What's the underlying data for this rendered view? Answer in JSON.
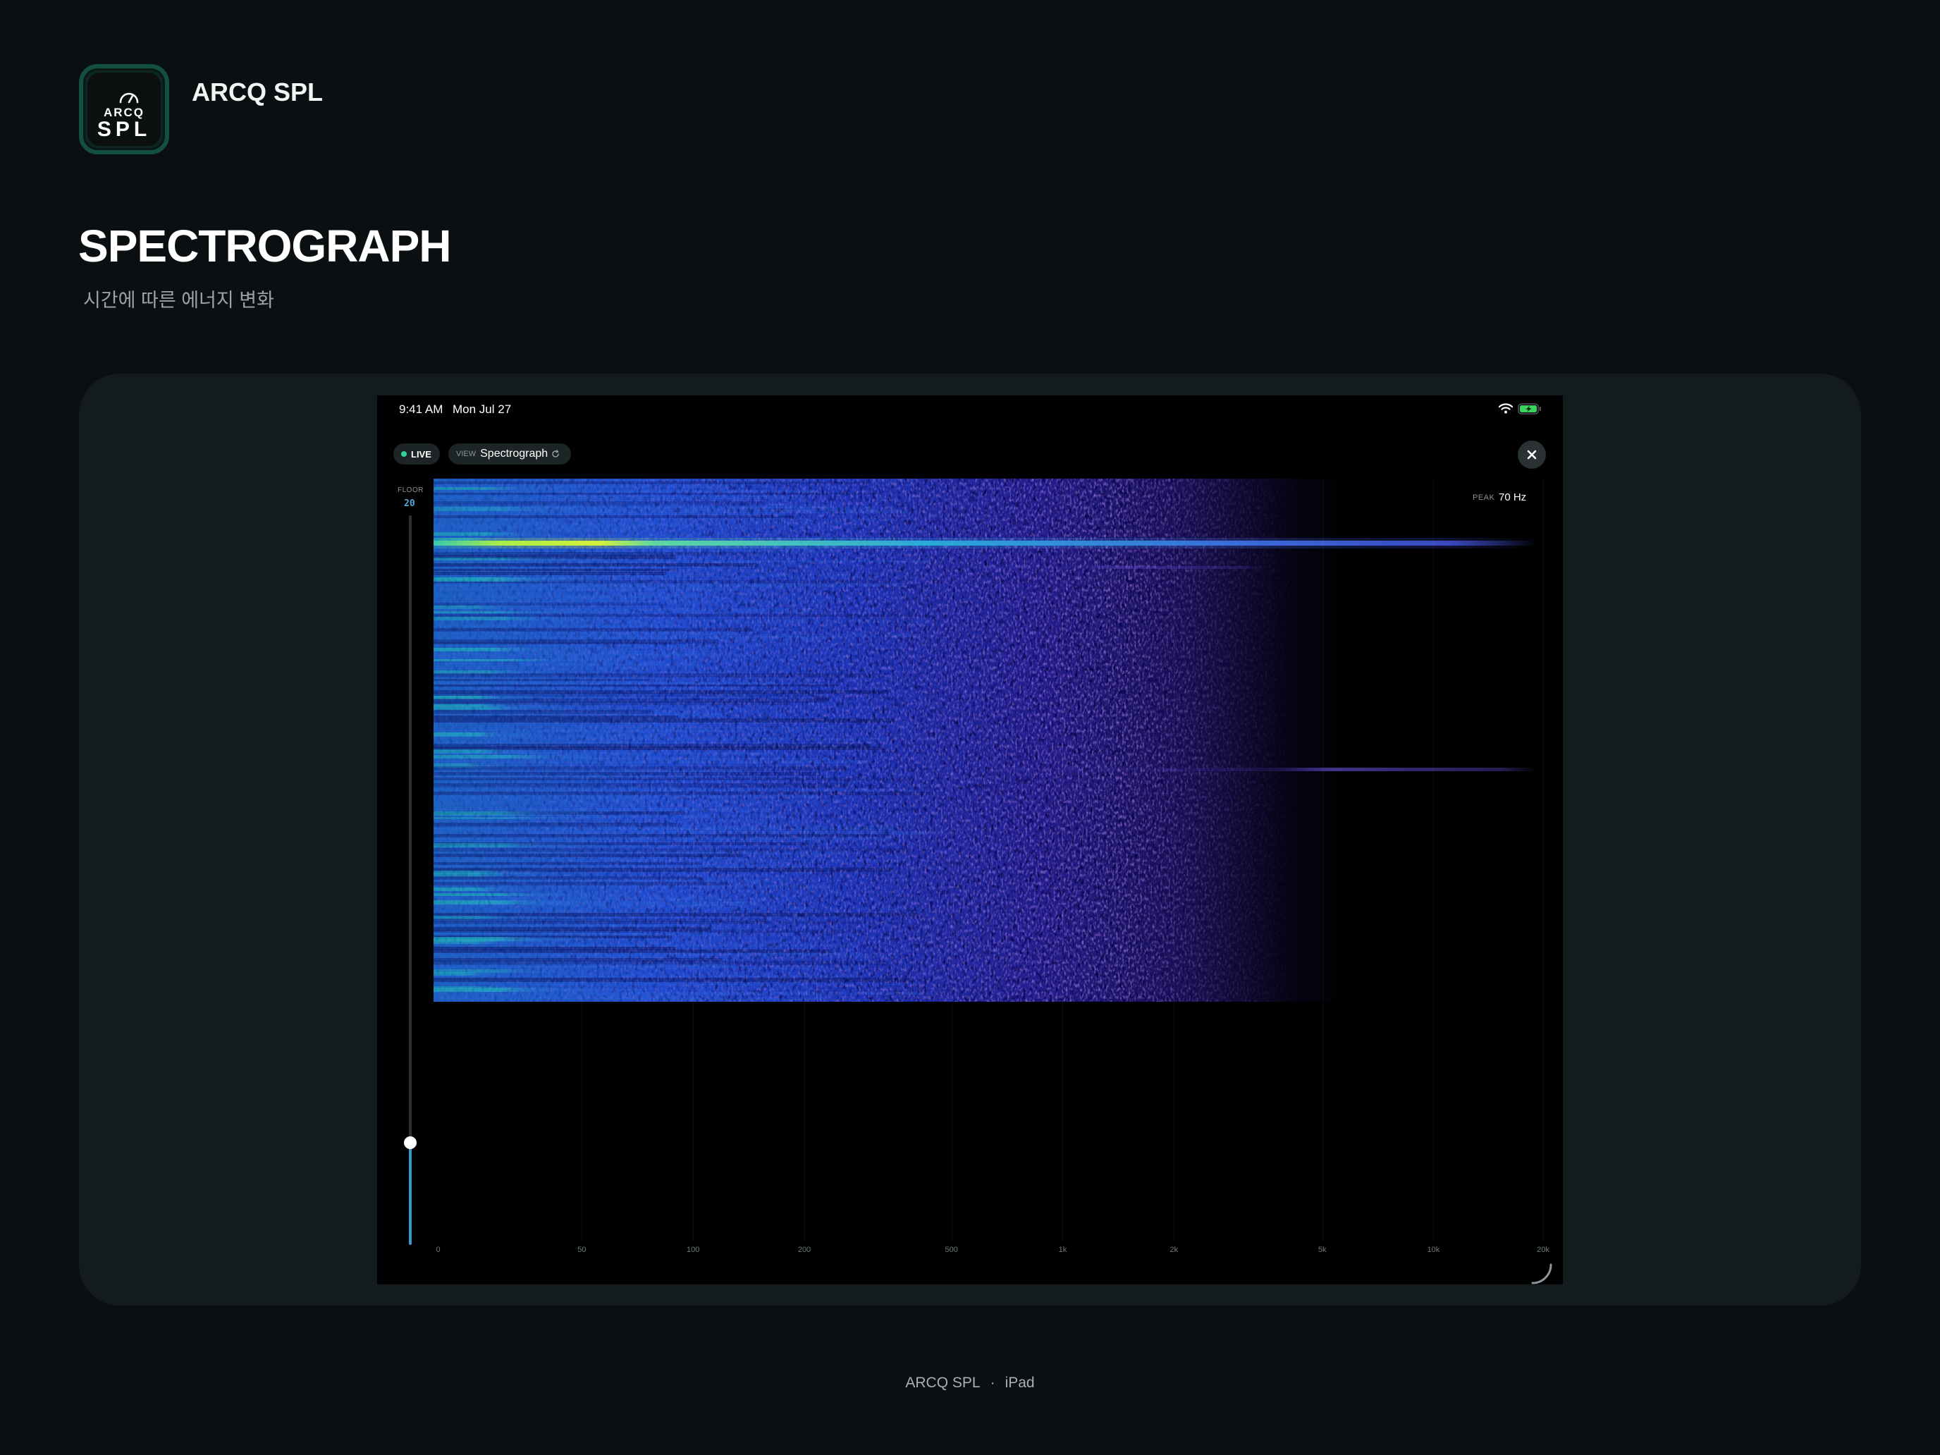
{
  "brand": {
    "icon_text_top": "ARCQ",
    "icon_text_bottom": "SPL",
    "app_name": "ARCQ SPL"
  },
  "page": {
    "title": "SPECTROGRAPH",
    "subtitle": "시간에 따른 에너지 변화"
  },
  "device": {
    "status_bar": {
      "time": "9:41 AM",
      "date": "Mon Jul 27",
      "wifi_icon": "wifi-icon",
      "battery_icon": "battery-charging-icon"
    },
    "toolbar": {
      "live_label": "LIVE",
      "live_color": "#2fd39a",
      "view_prefix": "VIEW",
      "view_value": "Spectrograph",
      "close_icon": "close-icon"
    },
    "floor": {
      "label": "FLOOR",
      "value": "20",
      "level_fraction": 0.14
    },
    "peak": {
      "label": "PEAK",
      "value": "70 Hz"
    },
    "x_ticks": [
      "0",
      "50",
      "100",
      "200",
      "500",
      "1k",
      "2k",
      "5k",
      "10k",
      "20k"
    ]
  },
  "footer": {
    "left": "ARCQ SPL",
    "separator": "·",
    "right": "iPad"
  }
}
